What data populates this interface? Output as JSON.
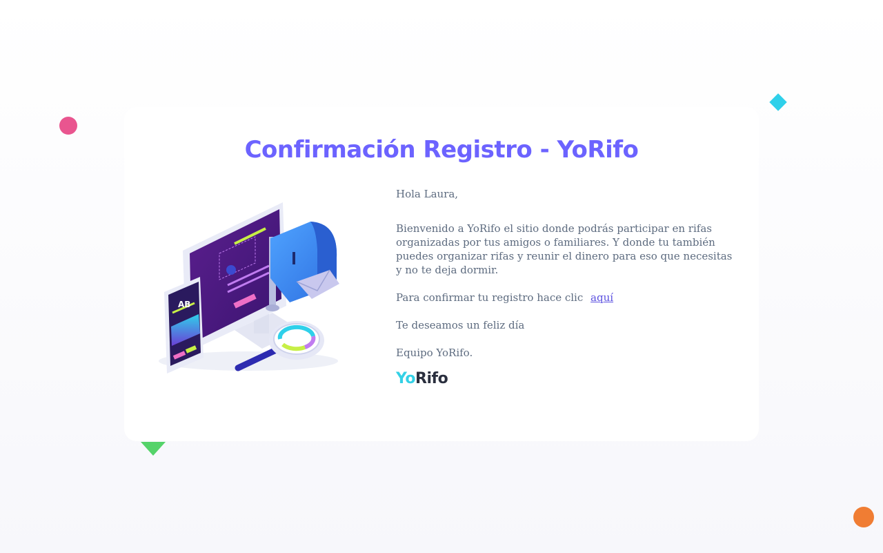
{
  "colors": {
    "title": "#6c63ff",
    "text": "#5d6b7f",
    "link": "#5b50e0",
    "logo_accent": "#34d1e6",
    "logo_dark": "#2a2f3e",
    "deco_pink": "#e9558f",
    "deco_cyan": "#2fd0ea",
    "deco_yellow": "#fddf8a",
    "deco_green": "#55d36a",
    "deco_orange": "#f07d33"
  },
  "email": {
    "title": "Confirmación Registro - YoRifo",
    "greeting": "Hola Laura,",
    "welcome": "Bienvenido a YoRifo el sitio donde podrás participar en rifas organizadas por tus amigos o familiares. Y donde tu también puedes organizar rifas y reunir el dinero para eso que necesitas y no te deja dormir.",
    "confirm_text": "Para confirmar tu registro hace clic",
    "confirm_link": "aquí",
    "wish": "Te deseamos un feliz día",
    "signature": "Equipo YoRifo.",
    "logo_part1": "Yo",
    "logo_part2": "Rifo",
    "illustration_phone_text": "AB"
  }
}
